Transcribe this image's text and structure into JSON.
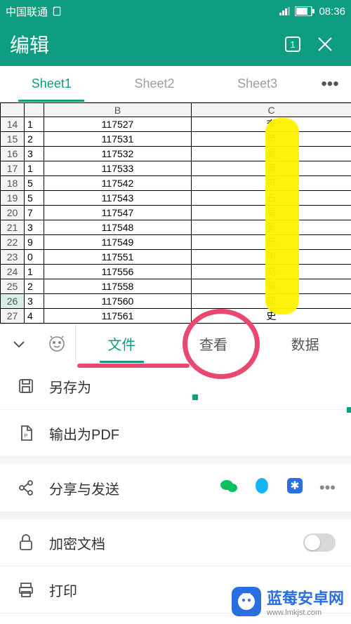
{
  "status": {
    "carrier": "中国联通",
    "time": "08:36"
  },
  "header": {
    "title": "编辑",
    "tab_badge": "1"
  },
  "sheets": {
    "tabs": [
      "Sheet1",
      "Sheet2",
      "Sheet3"
    ],
    "active": 0,
    "more": "•••"
  },
  "grid": {
    "col_headers": [
      "",
      "B",
      "C"
    ],
    "rows": [
      {
        "n": 14,
        "a": "1",
        "b": "117527",
        "c": "李"
      },
      {
        "n": 15,
        "a": "2",
        "b": "117531",
        "c": "黄"
      },
      {
        "n": 16,
        "a": "3",
        "b": "117532",
        "c": "吴"
      },
      {
        "n": 17,
        "a": "1",
        "b": "117533",
        "c": "黄"
      },
      {
        "n": 18,
        "a": "5",
        "b": "117542",
        "c": "符"
      },
      {
        "n": 19,
        "a": "5",
        "b": "117543",
        "c": "石"
      },
      {
        "n": 20,
        "a": "7",
        "b": "117547",
        "c": "吴"
      },
      {
        "n": 21,
        "a": "3",
        "b": "117548",
        "c": "吴"
      },
      {
        "n": 22,
        "a": "9",
        "b": "117549",
        "c": "阮"
      },
      {
        "n": 23,
        "a": "0",
        "b": "117551",
        "c": "周"
      },
      {
        "n": 24,
        "a": "1",
        "b": "117556",
        "c": "刘"
      },
      {
        "n": 25,
        "a": "2",
        "b": "117558",
        "c": "郑"
      },
      {
        "n": 26,
        "a": "3",
        "b": "117560",
        "c": "郭"
      },
      {
        "n": 27,
        "a": "4",
        "b": "117561",
        "c": "史"
      }
    ],
    "selected_row": 26
  },
  "toolbar": {
    "tabs": [
      "文件",
      "查看",
      "数据"
    ],
    "active": 0
  },
  "menu": {
    "save_as": "另存为",
    "export_pdf": "输出为PDF",
    "share": "分享与发送",
    "share_more": "•••",
    "share_colors": {
      "wechat": "#07c160",
      "qq": "#12b7f5",
      "star": "#2a6fe0"
    },
    "encrypt": "加密文档",
    "print": "打印"
  },
  "watermark": {
    "name": "蓝莓安卓网",
    "url": "www.lmkjst.com"
  }
}
